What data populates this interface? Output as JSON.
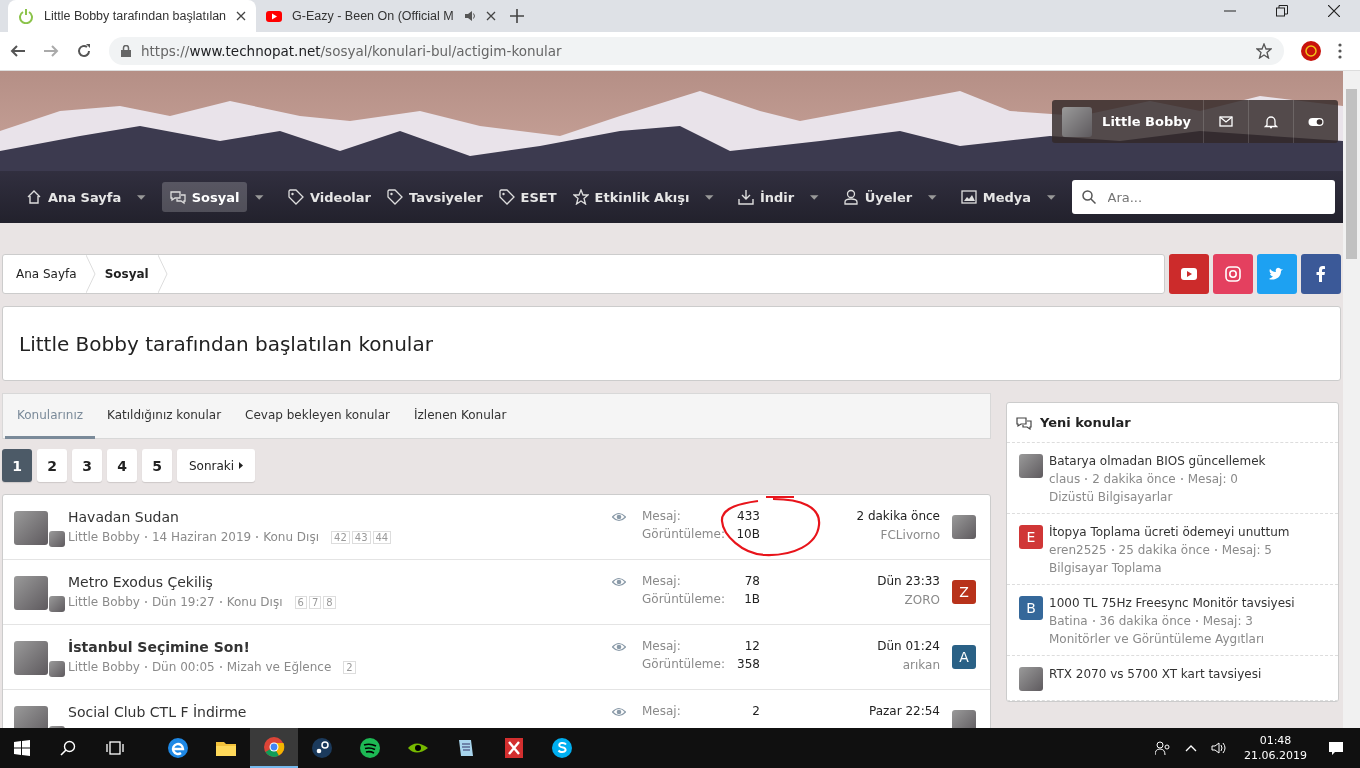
{
  "browser": {
    "tabs": [
      {
        "title": "Little Bobby tarafından başlatılan",
        "selected": true,
        "kind": "power",
        "audio": false
      },
      {
        "title": "G-Eazy - Been On (Official M",
        "selected": false,
        "kind": "video",
        "audio": true
      }
    ],
    "address": {
      "scheme": "https://",
      "host": "www.technopat.net",
      "path": "/sosyal/konulari-bul/actigim-konular"
    }
  },
  "header": {
    "user": {
      "name": "Little Bobby"
    },
    "nav": [
      {
        "label": "Ana Sayfa",
        "kind": "home",
        "selected": false,
        "dropdown": true
      },
      {
        "label": "Sosyal",
        "kind": "chat",
        "selected": true,
        "dropdown": true
      },
      {
        "label": "Videolar",
        "kind": "tag",
        "selected": false,
        "dropdown": false
      },
      {
        "label": "Tavsiyeler",
        "kind": "tag",
        "selected": false,
        "dropdown": false
      },
      {
        "label": "ESET",
        "kind": "tag",
        "selected": false,
        "dropdown": false
      },
      {
        "label": "Etkinlik Akışı",
        "kind": "star",
        "selected": false,
        "dropdown": true
      },
      {
        "label": "İndir",
        "kind": "download",
        "selected": false,
        "dropdown": true
      },
      {
        "label": "Üyeler",
        "kind": "user",
        "selected": false,
        "dropdown": true
      },
      {
        "label": "Medya",
        "kind": "image",
        "selected": false,
        "dropdown": true
      }
    ],
    "search": {
      "placeholder": "Ara..."
    }
  },
  "breadcrumb": [
    {
      "label": "Ana Sayfa",
      "current": false
    },
    {
      "label": "Sosyal",
      "current": true
    }
  ],
  "social": [
    {
      "kind": "youtube",
      "color": "#cc2b2b"
    },
    {
      "kind": "instagram",
      "color": "#e4405f"
    },
    {
      "kind": "twitter",
      "color": "#1da1f2"
    },
    {
      "kind": "facebook",
      "color": "#3b5998"
    }
  ],
  "page_title": "Little Bobby tarafından başlatılan konular",
  "filter_tabs": [
    {
      "label": "Konularınız",
      "selected": true
    },
    {
      "label": "Katıldığınız konular",
      "selected": false
    },
    {
      "label": "Cevap bekleyen konular",
      "selected": false
    },
    {
      "label": "İzlenen Konular",
      "selected": false
    }
  ],
  "pagination": {
    "pages": [
      {
        "label": "1",
        "selected": true
      },
      {
        "label": "2",
        "selected": false
      },
      {
        "label": "3",
        "selected": false
      },
      {
        "label": "4",
        "selected": false
      },
      {
        "label": "5",
        "selected": false
      }
    ],
    "next": "Sonraki"
  },
  "threads": [
    {
      "title": "Havadan Sudan",
      "unread": false,
      "author": "Little Bobby",
      "date": "14 Haziran 2019",
      "forum": "Konu Dışı",
      "pages": [
        "42",
        "43",
        "44"
      ],
      "replies_label": "Mesaj:",
      "replies": "433",
      "views_label": "Görüntüleme:",
      "views": "10B",
      "last_date": "2 dakika önce",
      "last_user": "FCLivorno",
      "last_avatar": {
        "kind": "photo"
      },
      "circled": true
    },
    {
      "title": "Metro Exodus Çekiliş",
      "unread": false,
      "author": "Little Bobby",
      "date": "Dün 19:27",
      "forum": "Konu Dışı",
      "pages": [
        "6",
        "7",
        "8"
      ],
      "replies_label": "Mesaj:",
      "replies": "78",
      "views_label": "Görüntüleme:",
      "views": "1B",
      "last_date": "Dün 23:33",
      "last_user": "ZORO",
      "last_avatar": {
        "kind": "letter",
        "letter": "Z",
        "color": "#b8321a"
      },
      "circled": false
    },
    {
      "title": "İstanbul Seçimine Son!",
      "unread": true,
      "author": "Little Bobby",
      "date": "Dün 00:05",
      "forum": "Mizah ve Eğlence",
      "pages": [
        "2"
      ],
      "replies_label": "Mesaj:",
      "replies": "12",
      "views_label": "Görüntüleme:",
      "views": "358",
      "last_date": "Dün 01:24",
      "last_user": "arıkan",
      "last_avatar": {
        "kind": "letter",
        "letter": "A",
        "color": "#2a6186"
      },
      "circled": false
    },
    {
      "title": "Social Club CTL F İndirme",
      "unread": false,
      "replies_label": "Mesaj:",
      "replies": "2",
      "last_date": "Pazar 22:54",
      "last_avatar": {
        "kind": "photo"
      },
      "circled": false
    }
  ],
  "sidebar": {
    "title": "Yeni konular",
    "items": [
      {
        "title": "Batarya olmadan BIOS güncellemek",
        "user": "claus",
        "time": "2 dakika önce",
        "replies": "Mesaj: 0",
        "forum": "Dizüstü Bilgisayarlar",
        "avatar": {
          "kind": "photo"
        }
      },
      {
        "title": "İtopya Toplama ücreti ödemeyi unuttum",
        "user": "eren2525",
        "time": "25 dakika önce",
        "replies": "Mesaj: 5",
        "forum": "Bilgisayar Toplama",
        "avatar": {
          "kind": "letter",
          "letter": "E",
          "color": "#d03636"
        }
      },
      {
        "title": "1000 TL 75Hz Freesync Monitör tavsiyesi",
        "user": "Batina",
        "time": "36 dakika önce",
        "replies": "Mesaj: 3",
        "forum": "Monitörler ve Görüntüleme Aygıtları",
        "avatar": {
          "kind": "letter",
          "letter": "B",
          "color": "#35689a"
        }
      },
      {
        "title": "RTX 2070 vs 5700 XT kart tavsiyesi",
        "avatar": {
          "kind": "photo"
        }
      }
    ]
  },
  "taskbar": {
    "apps": [
      {
        "kind": "edge",
        "selected": false
      },
      {
        "kind": "folder",
        "selected": false
      },
      {
        "kind": "chrome",
        "selected": true
      },
      {
        "kind": "steam",
        "selected": false
      },
      {
        "kind": "spotify",
        "selected": false
      },
      {
        "kind": "nvidia",
        "selected": false
      },
      {
        "kind": "notes",
        "selected": false
      },
      {
        "kind": "pdf",
        "selected": false
      },
      {
        "kind": "skype",
        "selected": false
      }
    ],
    "time": "01:48",
    "date": "21.06.2019"
  }
}
